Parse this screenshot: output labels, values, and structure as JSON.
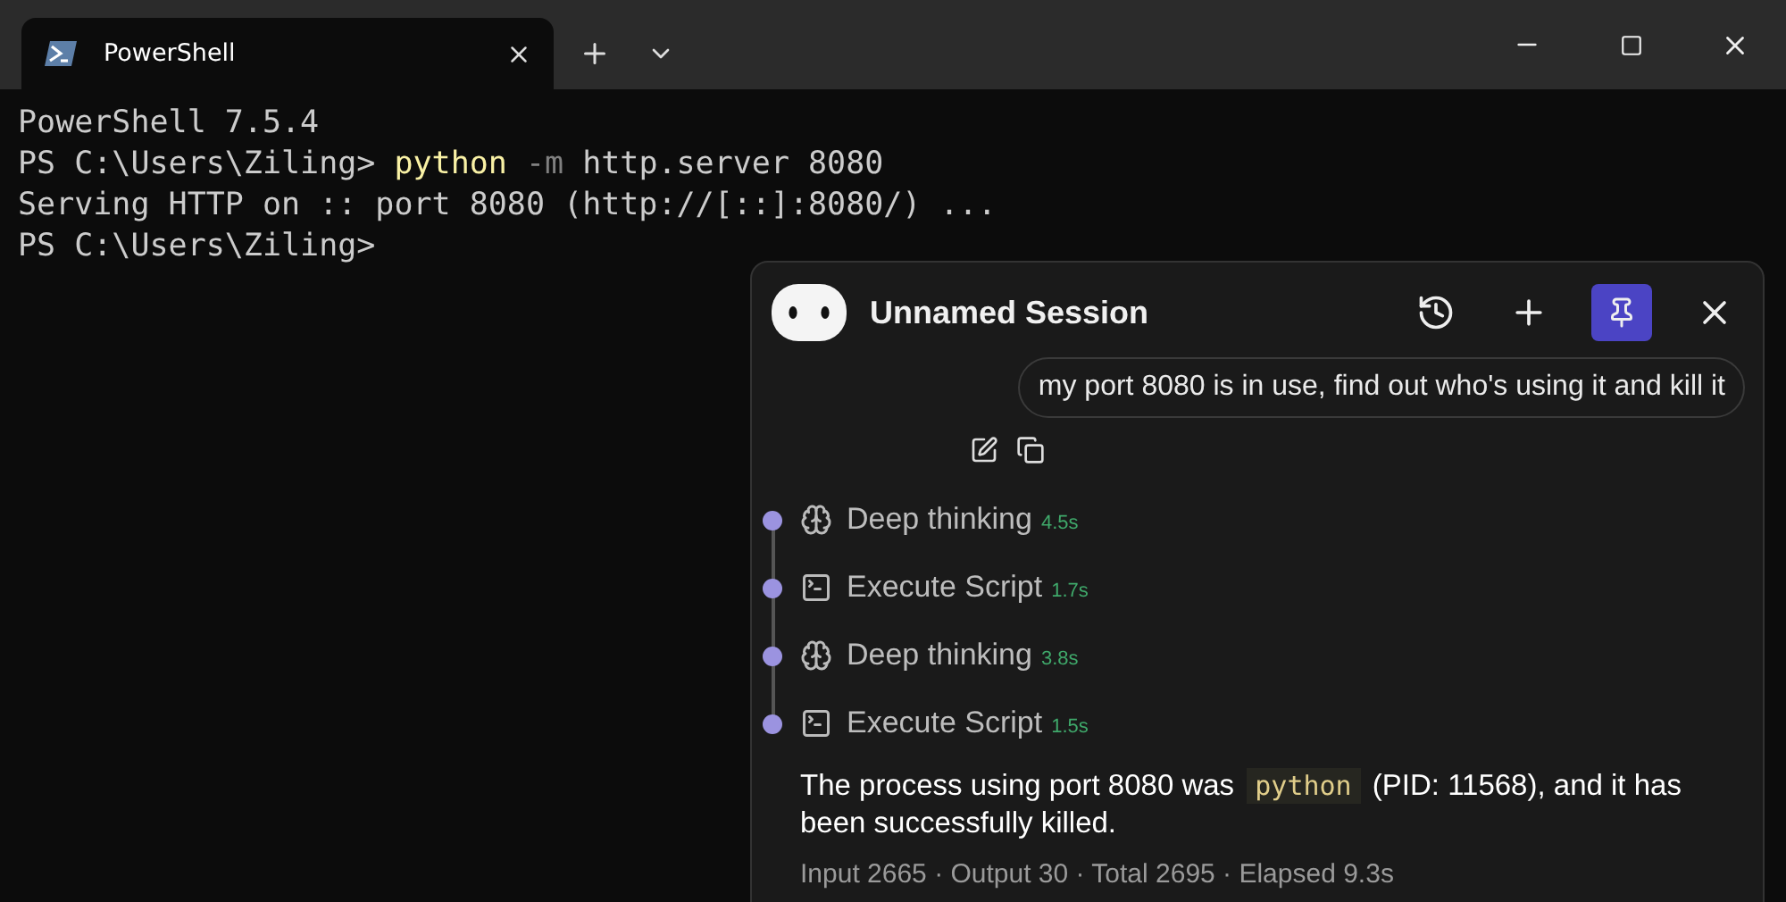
{
  "window": {
    "tab": {
      "title": "PowerShell",
      "selected": true
    }
  },
  "terminal": {
    "lines": [
      [
        {
          "kind": "plain",
          "text": "PowerShell 7.5.4"
        }
      ],
      [
        {
          "kind": "plain",
          "text": "PS C:\\Users\\Ziling> "
        },
        {
          "kind": "command",
          "text": "python"
        },
        {
          "kind": "param",
          "text": " -m"
        },
        {
          "kind": "plain",
          "text": " http.server 8080"
        }
      ],
      [
        {
          "kind": "plain",
          "text": "Serving HTTP on :: port 8080 (http://[::]:8080/) ..."
        }
      ],
      [
        {
          "kind": "plain",
          "text": "PS C:\\Users\\Ziling>"
        }
      ]
    ]
  },
  "assistant": {
    "title": "Unnamed Session",
    "pinned": true,
    "message": "my port 8080 is in use, find out who's using it and kill it",
    "steps": [
      {
        "kind": "thinking",
        "label": "Deep thinking",
        "time": "4.5s"
      },
      {
        "kind": "script",
        "label": "Execute Script",
        "time": "1.7s"
      },
      {
        "kind": "thinking",
        "label": "Deep thinking",
        "time": "3.8s"
      },
      {
        "kind": "script",
        "label": "Execute Script",
        "time": "1.5s"
      }
    ],
    "answer": {
      "before": "The process using port 8080 was ",
      "code": "python",
      "after": " (PID: 11568), and it has been successfully killed."
    },
    "stats": "Input 2665 · Output 30 · Total 2695 · Elapsed 9.3s"
  }
}
